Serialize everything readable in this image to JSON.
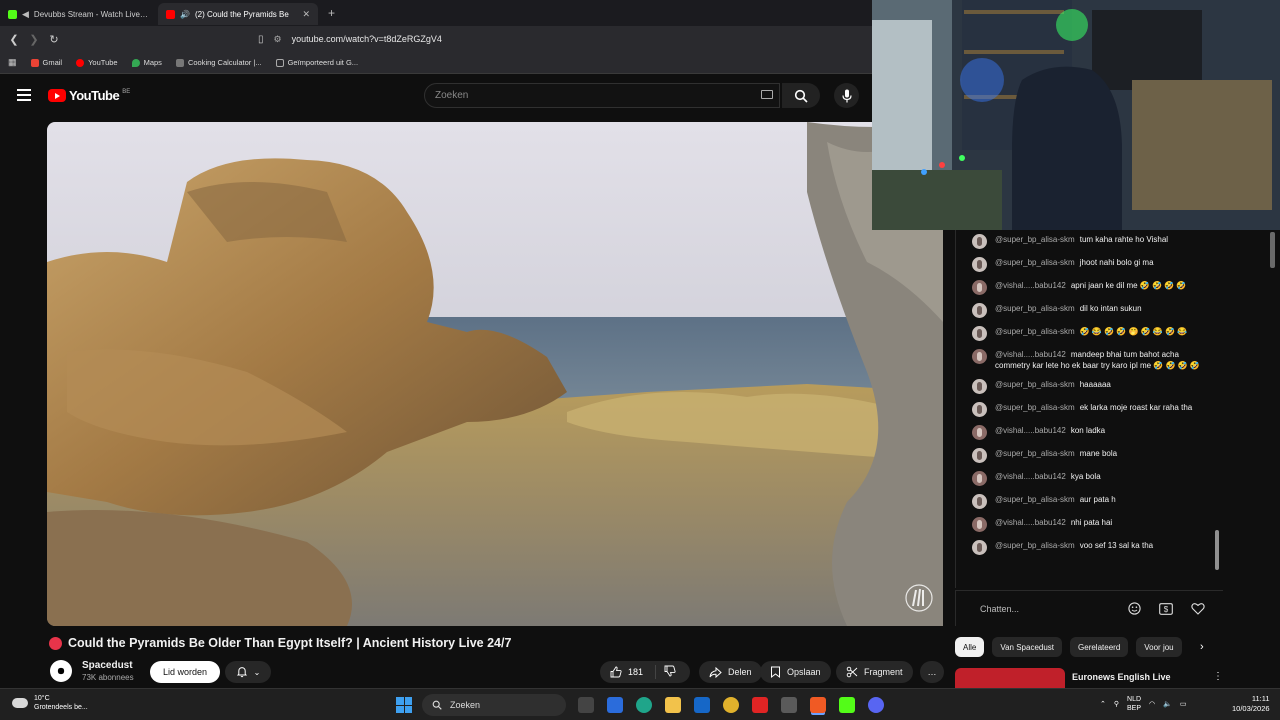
{
  "browser": {
    "tabs": [
      {
        "label": "Devubbs Stream - Watch Live on",
        "favicon_color": "#53fc18"
      },
      {
        "label": "(2) Could the Pyramids Be",
        "favicon_color": "#ff0000",
        "audio": "🔊"
      }
    ],
    "new_tab": "+",
    "url": "youtube.com/watch?v=t8dZeRGZgV4",
    "bookmarks": [
      {
        "label": "Gmail",
        "color": "#ea4335"
      },
      {
        "label": "YouTube",
        "color": "#ff0000"
      },
      {
        "label": "Maps",
        "color": "#34a853"
      },
      {
        "label": "Cooking Calculator |...",
        "color": "#777777"
      },
      {
        "label": "Geïmporteerd uit G...",
        "color": "#aaaaaa"
      }
    ]
  },
  "youtube": {
    "logo_text": "YouTube",
    "country_code": "BE",
    "search_placeholder": "Zoeken"
  },
  "video": {
    "title": "Could the Pyramids Be Older Than Egypt Itself? | Ancient History Live 24/7",
    "channel_name": "Spacedust",
    "subscribers": "73K abonnees",
    "join_label": "Lid worden",
    "likes": "181",
    "share_label": "Delen",
    "save_label": "Opslaan",
    "clip_label": "Fragment",
    "more_label": "…"
  },
  "chat": {
    "messages": [
      {
        "user": "@super_bp_alisa-skm",
        "text": "tum kaha rahte ho Vishal",
        "kind": "a"
      },
      {
        "user": "@super_bp_alisa-skm",
        "text": "jhoot nahi bolo gi ma",
        "kind": "a"
      },
      {
        "user": "@vishal.....babu142",
        "text": "apni jaan ke dil me 🤣 🤣 🤣 🤣",
        "kind": "v"
      },
      {
        "user": "@super_bp_alisa-skm",
        "text": "dil ko intan sukun",
        "kind": "a"
      },
      {
        "user": "@super_bp_alisa-skm",
        "text": "🤣 😂 🤣 🤣 🤭 🤣 😂 🤣 😂",
        "kind": "a"
      },
      {
        "user": "@vishal.....babu142",
        "text": "mandeep bhai tum bahot acha commetry kar lete ho ek baar try karo ipl me 🤣 🤣 🤣 🤣",
        "kind": "v"
      },
      {
        "user": "@super_bp_alisa-skm",
        "text": "haaaaaa",
        "kind": "a"
      },
      {
        "user": "@super_bp_alisa-skm",
        "text": "ek larka moje roast kar raha tha",
        "kind": "a"
      },
      {
        "user": "@vishal.....babu142",
        "text": "kon ladka",
        "kind": "v"
      },
      {
        "user": "@super_bp_alisa-skm",
        "text": "mane bola",
        "kind": "a"
      },
      {
        "user": "@vishal.....babu142",
        "text": "kya bola",
        "kind": "v"
      },
      {
        "user": "@super_bp_alisa-skm",
        "text": "aur pata h",
        "kind": "a"
      },
      {
        "user": "@vishal.....babu142",
        "text": "nhi pata hai",
        "kind": "v"
      },
      {
        "user": "@super_bp_alisa-skm",
        "text": "voo sef 13 sal ka tha",
        "kind": "a"
      }
    ],
    "input_placeholder": "Chatten..."
  },
  "recommendations": {
    "chips": [
      "Alle",
      "Van Spacedust",
      "Gerelateerd",
      "Voor jou"
    ],
    "first_title": "Euronews English Live"
  },
  "taskbar": {
    "weather_temp": "10°C",
    "weather_desc": "Grotendeels be...",
    "search_label": "Zoeken",
    "language": "NLD",
    "language_sub": "BEP",
    "time": "11:11",
    "date": "10/03/2026"
  }
}
